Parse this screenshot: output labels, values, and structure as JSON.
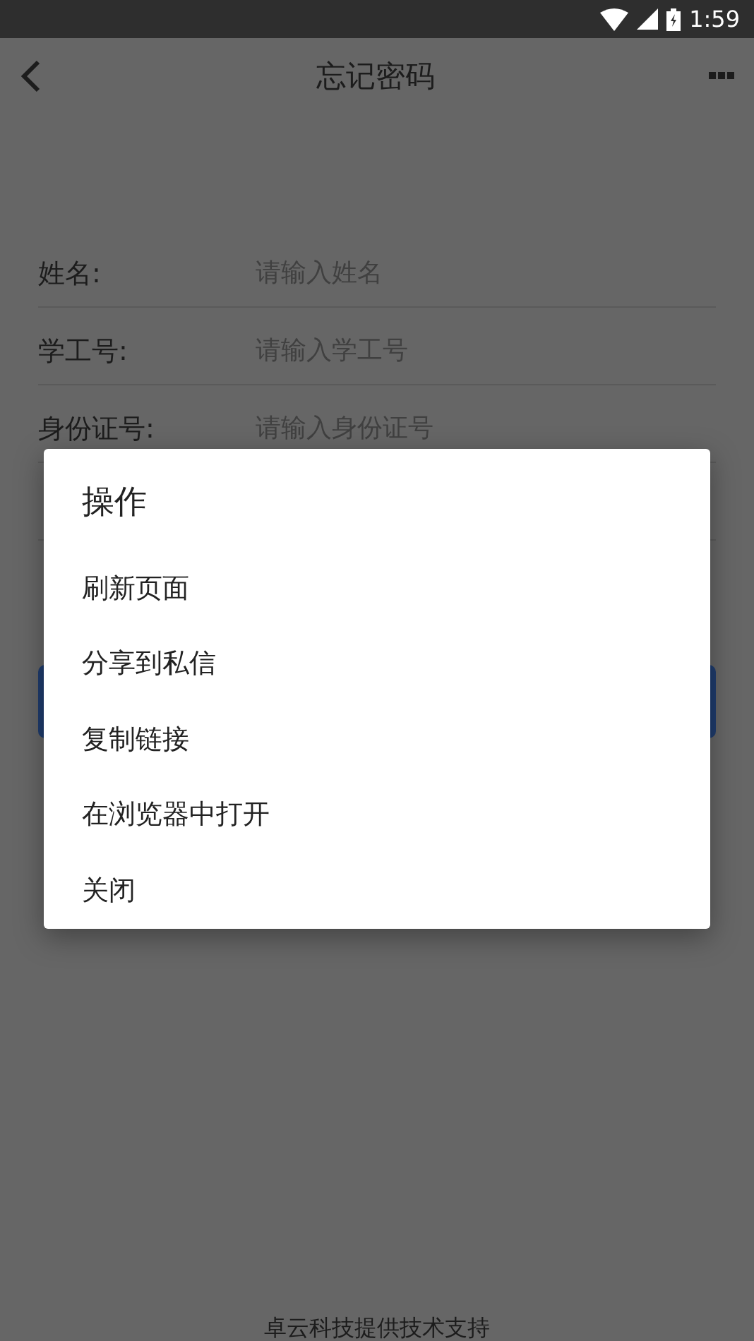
{
  "status_bar": {
    "time": "1:59"
  },
  "header": {
    "title": "忘记密码"
  },
  "form": {
    "fields": [
      {
        "label": "姓名:",
        "placeholder": "请输入姓名"
      },
      {
        "label": "学工号:",
        "placeholder": "请输入学工号"
      },
      {
        "label": "身份证号:",
        "placeholder": "请输入身份证号"
      }
    ]
  },
  "footer": "卓云科技提供技术支持",
  "dialog": {
    "title": "操作",
    "items": [
      "刷新页面",
      "分享到私信",
      "复制链接",
      "在浏览器中打开",
      "关闭"
    ]
  }
}
